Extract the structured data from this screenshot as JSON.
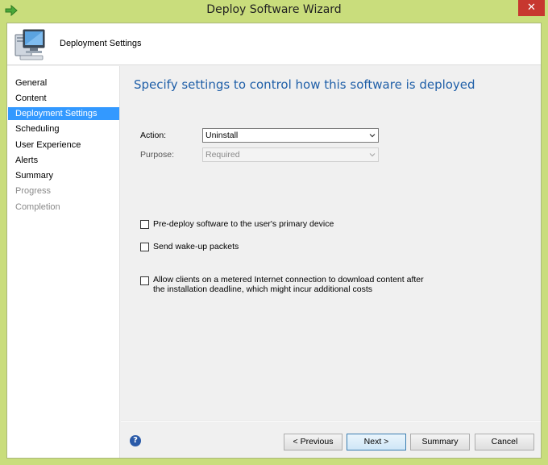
{
  "window": {
    "title": "Deploy Software Wizard",
    "close_glyph": "✕"
  },
  "header": {
    "title": "Deployment Settings",
    "icon": "computer-icon"
  },
  "nav": {
    "items": [
      {
        "label": "General",
        "state": "normal"
      },
      {
        "label": "Content",
        "state": "normal"
      },
      {
        "label": "Deployment Settings",
        "state": "active"
      },
      {
        "label": "Scheduling",
        "state": "normal"
      },
      {
        "label": "User Experience",
        "state": "normal"
      },
      {
        "label": "Alerts",
        "state": "normal"
      },
      {
        "label": "Summary",
        "state": "normal"
      },
      {
        "label": "Progress",
        "state": "disabled"
      },
      {
        "label": "Completion",
        "state": "disabled"
      }
    ]
  },
  "main": {
    "heading": "Specify settings to control how this software is deployed",
    "action": {
      "label": "Action:",
      "value": "Uninstall"
    },
    "purpose": {
      "label": "Purpose:",
      "value": "Required"
    },
    "checkboxes": [
      {
        "label": "Pre-deploy software to the user's primary device",
        "checked": false
      },
      {
        "label": "Send wake-up packets",
        "checked": false
      },
      {
        "label": "Allow clients on a metered Internet connection to download content after the installation deadline, which might incur additional costs",
        "checked": false
      }
    ]
  },
  "footer": {
    "help": "?",
    "previous": "< Previous",
    "next": "Next >",
    "summary": "Summary",
    "cancel": "Cancel"
  },
  "colors": {
    "frame": "#c9dd7c",
    "accent": "#3399ff",
    "heading": "#1f5fa8",
    "close": "#c7372f"
  }
}
